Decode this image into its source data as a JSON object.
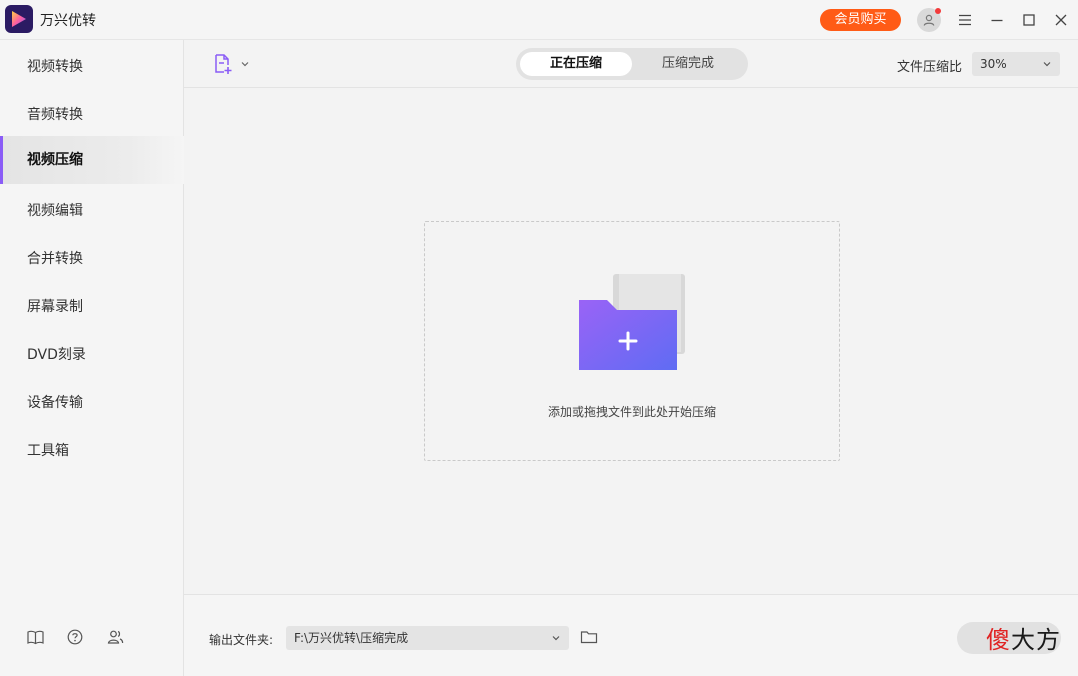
{
  "app": {
    "title": "万兴优转"
  },
  "titlebar": {
    "vip_label": "会员购买"
  },
  "sidebar": {
    "items": [
      {
        "label": "视频转换",
        "active": false
      },
      {
        "label": "音频转换",
        "active": false
      },
      {
        "label": "视频压缩",
        "active": true
      },
      {
        "label": "视频编辑",
        "active": false
      },
      {
        "label": "合并转换",
        "active": false
      },
      {
        "label": "屏幕录制",
        "active": false
      },
      {
        "label": "DVD刻录",
        "active": false
      },
      {
        "label": "设备传输",
        "active": false
      },
      {
        "label": "工具箱",
        "active": false
      }
    ],
    "bottom_icons": [
      "book-icon",
      "help-icon",
      "users-icon"
    ]
  },
  "toolbar": {
    "tabs": [
      {
        "label": "正在压缩",
        "active": true
      },
      {
        "label": "压缩完成",
        "active": false
      }
    ],
    "ratio_label": "文件压缩比",
    "ratio_value": "30%"
  },
  "dropzone": {
    "hint": "添加或拖拽文件到此处开始压缩"
  },
  "bottom": {
    "output_label": "输出文件夹:",
    "output_path": "F:\\万兴优转\\压缩完成"
  },
  "watermark": {
    "red": "傻",
    "rest": "大方"
  },
  "colors": {
    "accent": "#8a5cf6",
    "vip": "#ff5b16",
    "folder_from": "#9a63f6",
    "folder_to": "#5f6cf3"
  }
}
